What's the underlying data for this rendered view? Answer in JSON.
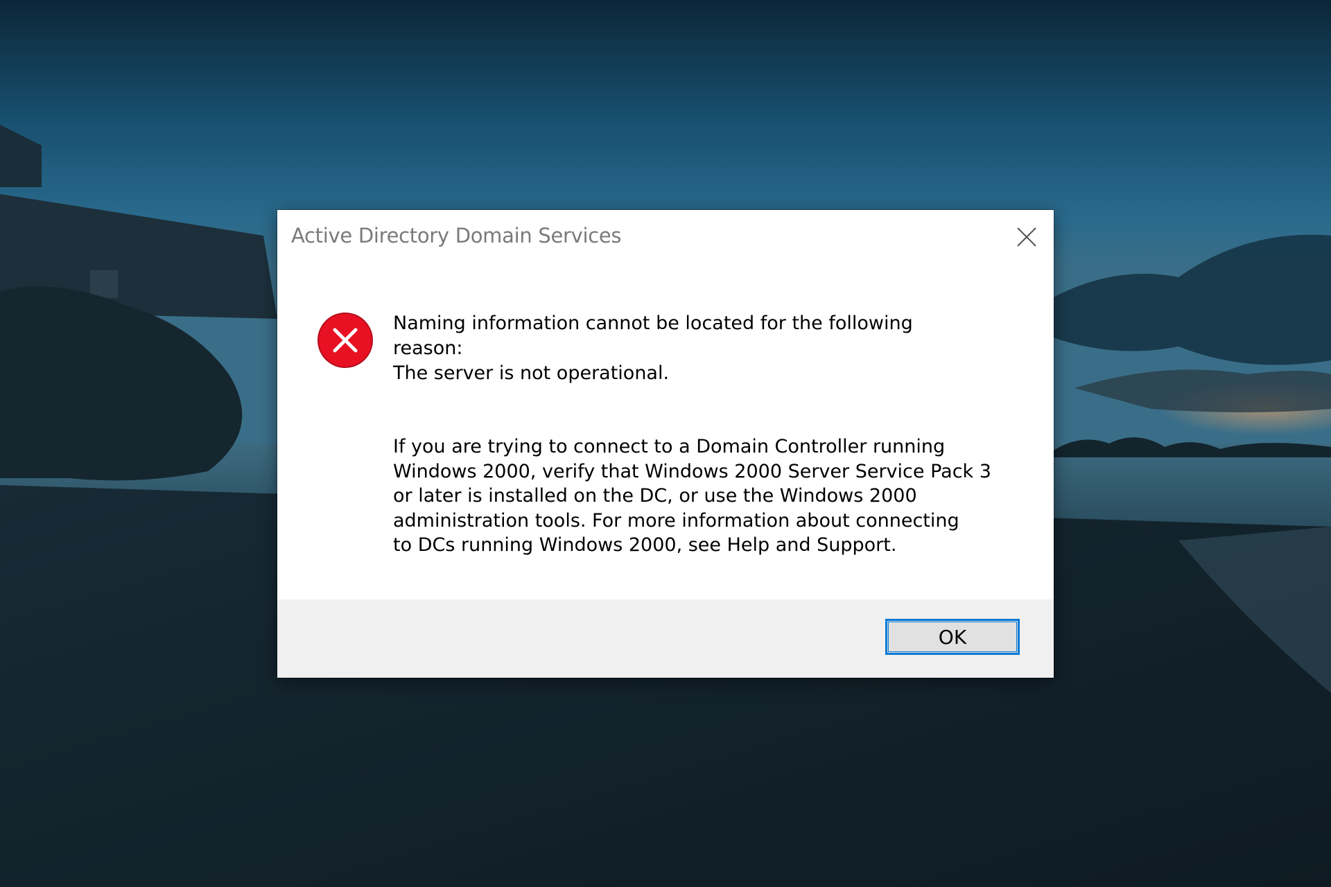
{
  "dialog": {
    "title": "Active Directory Domain Services",
    "icon": "error-icon",
    "message_lines": [
      "Naming information cannot be located for the following",
      "reason:",
      "The server is not operational."
    ],
    "detail_lines": [
      "If you are trying to connect to a Domain Controller running",
      "Windows 2000, verify that Windows 2000 Server Service Pack 3",
      "or later is installed on the DC, or use the Windows 2000",
      "administration tools. For more information about connecting",
      "to DCs running Windows 2000, see Help and Support."
    ],
    "ok_label": "OK"
  },
  "colors": {
    "error_red": "#e81123",
    "accent": "#0078d7",
    "footer_bg": "#f0f0f0"
  }
}
